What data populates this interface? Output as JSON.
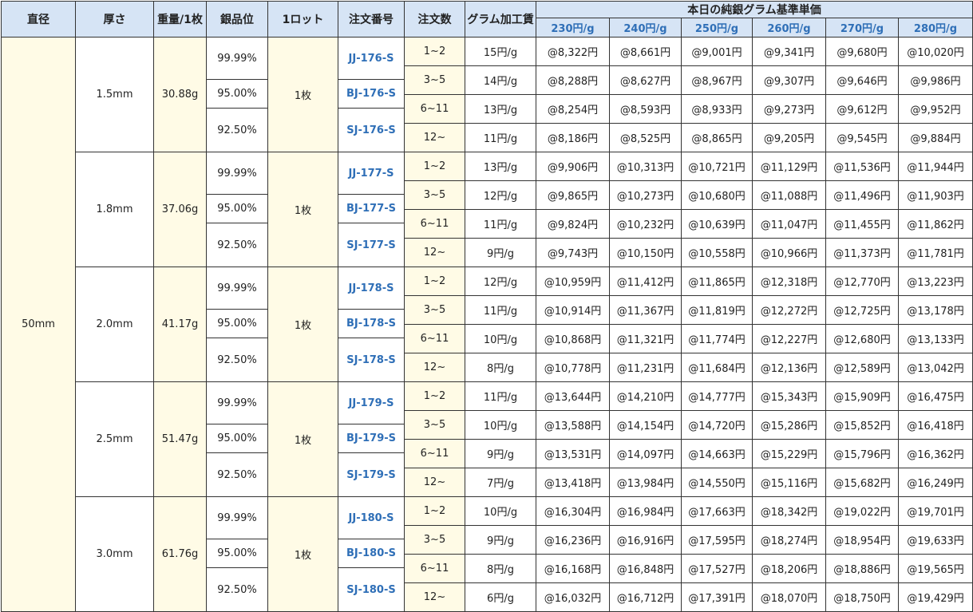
{
  "headers": {
    "diameter": "直径",
    "thickness": "厚さ",
    "weight": "重量/1枚",
    "purity": "銀品位",
    "lot": "1ロット",
    "code": "注文番号",
    "qty": "注文数",
    "fee": "グラム加工賃",
    "base_price": "本日の純銀グラム基準単価",
    "price_levels": [
      "230円/g",
      "240円/g",
      "250円/g",
      "260円/g",
      "270円/g",
      "280円/g"
    ]
  },
  "diameter": "50mm",
  "groups": [
    {
      "thickness": "1.5mm",
      "weight": "30.88g",
      "lot": "1枚",
      "variants": [
        {
          "purity": "99.99%",
          "code": "JJ-176-S"
        },
        {
          "purity": "95.00%",
          "code": "BJ-176-S"
        },
        {
          "purity": "92.50%",
          "code": "SJ-176-S"
        }
      ],
      "tiers": [
        {
          "qty": "1~2",
          "fee": "15円/g",
          "prices": [
            "@8,322円",
            "@8,661円",
            "@9,001円",
            "@9,341円",
            "@9,680円",
            "@10,020円"
          ]
        },
        {
          "qty": "3~5",
          "fee": "14円/g",
          "prices": [
            "@8,288円",
            "@8,627円",
            "@8,967円",
            "@9,307円",
            "@9,646円",
            "@9,986円"
          ]
        },
        {
          "qty": "6~11",
          "fee": "13円/g",
          "prices": [
            "@8,254円",
            "@8,593円",
            "@8,933円",
            "@9,273円",
            "@9,612円",
            "@9,952円"
          ]
        },
        {
          "qty": "12~",
          "fee": "11円/g",
          "prices": [
            "@8,186円",
            "@8,525円",
            "@8,865円",
            "@9,205円",
            "@9,545円",
            "@9,884円"
          ]
        }
      ]
    },
    {
      "thickness": "1.8mm",
      "weight": "37.06g",
      "lot": "1枚",
      "variants": [
        {
          "purity": "99.99%",
          "code": "JJ-177-S"
        },
        {
          "purity": "95.00%",
          "code": "BJ-177-S"
        },
        {
          "purity": "92.50%",
          "code": "SJ-177-S"
        }
      ],
      "tiers": [
        {
          "qty": "1~2",
          "fee": "13円/g",
          "prices": [
            "@9,906円",
            "@10,313円",
            "@10,721円",
            "@11,129円",
            "@11,536円",
            "@11,944円"
          ]
        },
        {
          "qty": "3~5",
          "fee": "12円/g",
          "prices": [
            "@9,865円",
            "@10,273円",
            "@10,680円",
            "@11,088円",
            "@11,496円",
            "@11,903円"
          ]
        },
        {
          "qty": "6~11",
          "fee": "11円/g",
          "prices": [
            "@9,824円",
            "@10,232円",
            "@10,639円",
            "@11,047円",
            "@11,455円",
            "@11,862円"
          ]
        },
        {
          "qty": "12~",
          "fee": "9円/g",
          "prices": [
            "@9,743円",
            "@10,150円",
            "@10,558円",
            "@10,966円",
            "@11,373円",
            "@11,781円"
          ]
        }
      ]
    },
    {
      "thickness": "2.0mm",
      "weight": "41.17g",
      "lot": "1枚",
      "variants": [
        {
          "purity": "99.99%",
          "code": "JJ-178-S"
        },
        {
          "purity": "95.00%",
          "code": "BJ-178-S"
        },
        {
          "purity": "92.50%",
          "code": "SJ-178-S"
        }
      ],
      "tiers": [
        {
          "qty": "1~2",
          "fee": "12円/g",
          "prices": [
            "@10,959円",
            "@11,412円",
            "@11,865円",
            "@12,318円",
            "@12,770円",
            "@13,223円"
          ]
        },
        {
          "qty": "3~5",
          "fee": "11円/g",
          "prices": [
            "@10,914円",
            "@11,367円",
            "@11,819円",
            "@12,272円",
            "@12,725円",
            "@13,178円"
          ]
        },
        {
          "qty": "6~11",
          "fee": "10円/g",
          "prices": [
            "@10,868円",
            "@11,321円",
            "@11,774円",
            "@12,227円",
            "@12,680円",
            "@13,133円"
          ]
        },
        {
          "qty": "12~",
          "fee": "8円/g",
          "prices": [
            "@10,778円",
            "@11,231円",
            "@11,684円",
            "@12,136円",
            "@12,589円",
            "@13,042円"
          ]
        }
      ]
    },
    {
      "thickness": "2.5mm",
      "weight": "51.47g",
      "lot": "1枚",
      "variants": [
        {
          "purity": "99.99%",
          "code": "JJ-179-S"
        },
        {
          "purity": "95.00%",
          "code": "BJ-179-S"
        },
        {
          "purity": "92.50%",
          "code": "SJ-179-S"
        }
      ],
      "tiers": [
        {
          "qty": "1~2",
          "fee": "11円/g",
          "prices": [
            "@13,644円",
            "@14,210円",
            "@14,777円",
            "@15,343円",
            "@15,909円",
            "@16,475円"
          ]
        },
        {
          "qty": "3~5",
          "fee": "10円/g",
          "prices": [
            "@13,588円",
            "@14,154円",
            "@14,720円",
            "@15,286円",
            "@15,852円",
            "@16,418円"
          ]
        },
        {
          "qty": "6~11",
          "fee": "9円/g",
          "prices": [
            "@13,531円",
            "@14,097円",
            "@14,663円",
            "@15,229円",
            "@15,796円",
            "@16,362円"
          ]
        },
        {
          "qty": "12~",
          "fee": "7円/g",
          "prices": [
            "@13,418円",
            "@13,984円",
            "@14,550円",
            "@15,116円",
            "@15,682円",
            "@16,249円"
          ]
        }
      ]
    },
    {
      "thickness": "3.0mm",
      "weight": "61.76g",
      "lot": "1枚",
      "variants": [
        {
          "purity": "99.99%",
          "code": "JJ-180-S"
        },
        {
          "purity": "95.00%",
          "code": "BJ-180-S"
        },
        {
          "purity": "92.50%",
          "code": "SJ-180-S"
        }
      ],
      "tiers": [
        {
          "qty": "1~2",
          "fee": "10円/g",
          "prices": [
            "@16,304円",
            "@16,984円",
            "@17,663円",
            "@18,342円",
            "@19,022円",
            "@19,701円"
          ]
        },
        {
          "qty": "3~5",
          "fee": "9円/g",
          "prices": [
            "@16,236円",
            "@16,916円",
            "@17,595円",
            "@18,274円",
            "@18,954円",
            "@19,633円"
          ]
        },
        {
          "qty": "6~11",
          "fee": "8円/g",
          "prices": [
            "@16,168円",
            "@16,848円",
            "@17,527円",
            "@18,206円",
            "@18,886円",
            "@19,565円"
          ]
        },
        {
          "qty": "12~",
          "fee": "6円/g",
          "prices": [
            "@16,032円",
            "@16,712円",
            "@17,391円",
            "@18,070円",
            "@18,750円",
            "@19,429円"
          ]
        }
      ]
    }
  ]
}
